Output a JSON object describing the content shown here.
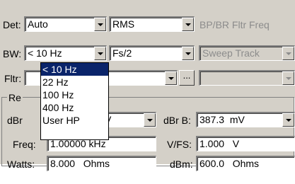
{
  "row1": {
    "det_label": "Det:",
    "det_value": "Auto",
    "rms_value": "RMS",
    "bpbr_label": "BP/BR Fltr Freq"
  },
  "row2": {
    "bw_label": "BW:",
    "bw_value": "< 10 Hz",
    "fs_value": "Fs/2",
    "sweep_track_value": "Sweep Track"
  },
  "row3": {
    "fltr_label": "Fltr:",
    "fltr_value": "",
    "ellipsis_label": "...",
    "right_value": ""
  },
  "group": {
    "title": "Re"
  },
  "row4": {
    "dbr_label": "dBr",
    "dbr_unit": "V",
    "dbrb_label": "dBr B:",
    "dbrb_value": "387.3  mV"
  },
  "row5": {
    "freq_label": "Freq:",
    "freq_value": "1.00000 kHz",
    "vfs_label": "V/FS:",
    "vfs_value": "1.000   V"
  },
  "row6": {
    "watts_label": "Watts:",
    "watts_value": "8.000   Ohms",
    "dbm_label": "dBm:",
    "dbm_value": "600.0   Ohms"
  },
  "bw_dropdown": {
    "options": [
      "< 10 Hz",
      "22 Hz",
      "100 Hz",
      "400 Hz",
      "User HP"
    ],
    "selected_index": 0
  }
}
